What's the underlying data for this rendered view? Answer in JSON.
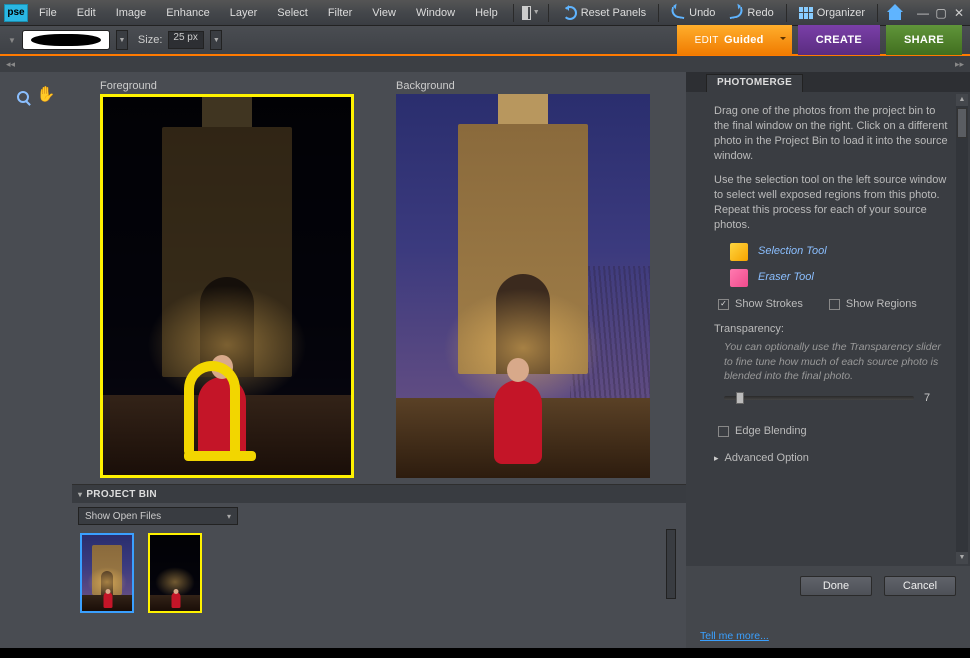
{
  "app": {
    "logo": "pse"
  },
  "menu": {
    "items": [
      "File",
      "Edit",
      "Image",
      "Enhance",
      "Layer",
      "Select",
      "Filter",
      "View",
      "Window",
      "Help"
    ]
  },
  "top_actions": {
    "reset_panels": "Reset Panels",
    "undo": "Undo",
    "redo": "Redo",
    "organizer": "Organizer"
  },
  "options_bar": {
    "size_label": "Size:",
    "size_value": "25 px"
  },
  "modes": {
    "guided_prefix": "EDIT",
    "guided": "Guided",
    "create": "CREATE",
    "share": "SHARE"
  },
  "workspace": {
    "foreground_label": "Foreground",
    "background_label": "Background"
  },
  "project_bin": {
    "title": "PROJECT BIN",
    "dropdown": "Show Open Files"
  },
  "panel": {
    "tab": "PHOTOMERGE",
    "intro1": "Drag one of the photos from the project bin to the final window on the right. Click on a different photo in the Project Bin to load it into the source window.",
    "intro2": "Use the selection tool on the left source window to select well exposed regions from this photo. Repeat this process for each of your source photos.",
    "selection_tool": "Selection Tool",
    "eraser_tool": "Eraser Tool",
    "show_strokes": "Show Strokes",
    "show_regions": "Show Regions",
    "transparency_label": "Transparency:",
    "transparency_hint": "You can optionally use the Transparency slider to fine tune how much of each source photo is blended into the final photo.",
    "transparency_value": "7",
    "edge_blending": "Edge Blending",
    "advanced_option": "Advanced Option"
  },
  "footer": {
    "done": "Done",
    "cancel": "Cancel",
    "tell_me_more": "Tell me more..."
  }
}
